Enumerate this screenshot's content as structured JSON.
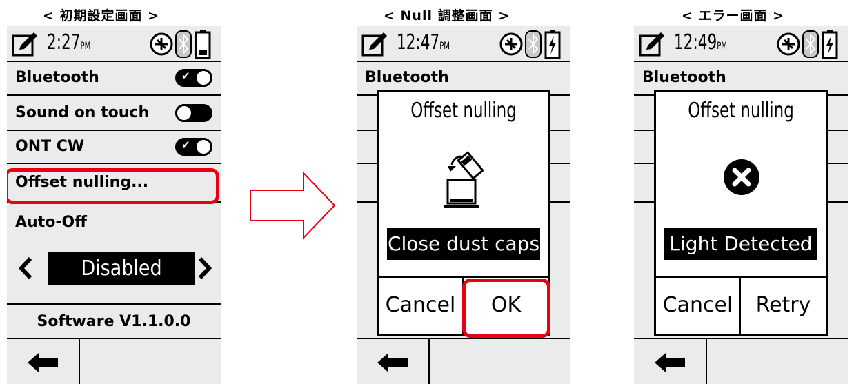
{
  "captions": {
    "initial": "< 初期設定画面 >",
    "null_adjust": "< Null 調整画面 >",
    "error": "< エラー画面 >"
  },
  "accent_color": "#e60012",
  "screens": {
    "initial": {
      "time": "2:27",
      "ampm": "PM",
      "rows": {
        "bluetooth": "Bluetooth",
        "sound": "Sound on touch",
        "ontcw": "ONT CW",
        "offset": "Offset nulling...",
        "autooff": "Auto-Off"
      },
      "toggles": {
        "bluetooth": "on",
        "sound": "off",
        "ontcw": "on"
      },
      "autooff_value": "Disabled",
      "software": "Software V1.1.0.0"
    },
    "null_adjust": {
      "time": "12:47",
      "ampm": "PM",
      "behind_label": "Bluetooth",
      "dialog_title": "Offset nulling",
      "message": "Close dust caps",
      "cancel": "Cancel",
      "ok": "OK"
    },
    "error": {
      "time": "12:49",
      "ampm": "PM",
      "behind_label": "Bluetooth",
      "dialog_title": "Offset nulling",
      "message": "Light Detected",
      "cancel": "Cancel",
      "retry": "Retry"
    }
  }
}
